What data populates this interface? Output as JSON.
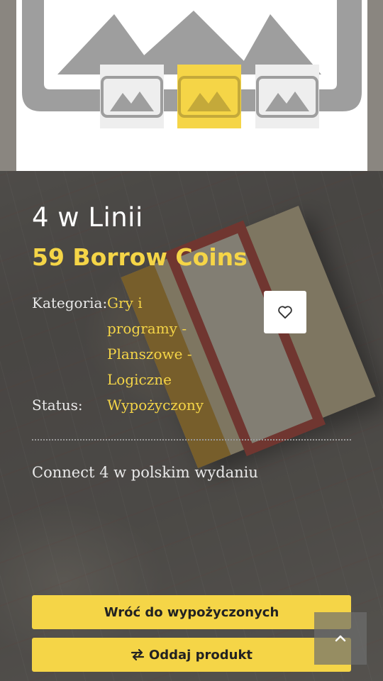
{
  "product": {
    "title": "4 w Linii",
    "price": "59 Borrow Coins",
    "description": "Connect 4 w polskim wydaniu"
  },
  "meta": {
    "category_label": "Kategoria:",
    "category_value": "Gry i programy - Planszowe - Logiczne",
    "status_label": "Status:",
    "status_value": "Wypożyczony"
  },
  "actions": {
    "back_label": "Wróć do wypożyczonych",
    "return_label": "Oddaj produkt"
  },
  "icons": {
    "favorite": "heart-icon",
    "return": "exchange-icon",
    "scroll_top": "chevron-up-icon",
    "placeholder": "image-placeholder-icon"
  },
  "colors": {
    "accent": "#f5d547",
    "text_light": "#e9e9e9",
    "button_text": "#222222"
  },
  "gallery": {
    "thumbnails": 3,
    "active_thumbnail": 2
  }
}
